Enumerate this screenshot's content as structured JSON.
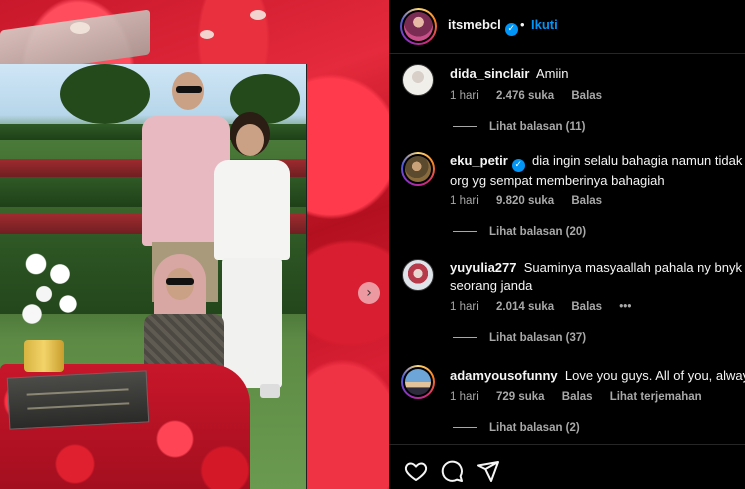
{
  "post": {
    "account": "itsmebcl",
    "verified": true,
    "follow_label": "Ikuti",
    "separator": "•"
  },
  "comments": [
    {
      "username": "dida_sinclair",
      "text": "Amiin",
      "time": "1 hari",
      "likes": "2.476 suka",
      "reply_label": "Balas",
      "view_replies": "Lihat balasan (11)"
    },
    {
      "username": "eku_petir",
      "verified": true,
      "text_line1": "dia ingin selalu bahagia namun tidak lu",
      "text_line2": "org yg sempat memberinya bahagiah",
      "time": "1 hari",
      "likes": "9.820 suka",
      "reply_label": "Balas",
      "view_replies": "Lihat balasan (20)"
    },
    {
      "username": "yuyulia277",
      "text_line1": "Suaminya masyaallah pahala ny bnyk m",
      "text_line2": "seorang janda",
      "time": "1 hari",
      "likes": "2.014 suka",
      "reply_label": "Balas",
      "more": "•••",
      "view_replies": "Lihat balasan (37)"
    },
    {
      "username": "adamyousofunny",
      "text": "Love you guys. All of you, always",
      "time": "1 hari",
      "likes": "729 suka",
      "reply_label": "Balas",
      "translate_label": "Lihat terjemahan",
      "view_replies": "Lihat balasan (2)"
    }
  ],
  "icons": {
    "like": "heart-icon",
    "comment": "comment-icon",
    "share": "share-icon",
    "next": "chevron-right-icon",
    "verified": "verified-badge-icon"
  },
  "colors": {
    "background": "#000000",
    "text": "#f5f5f5",
    "muted": "#a8a8a8",
    "accent": "#0095f6"
  }
}
